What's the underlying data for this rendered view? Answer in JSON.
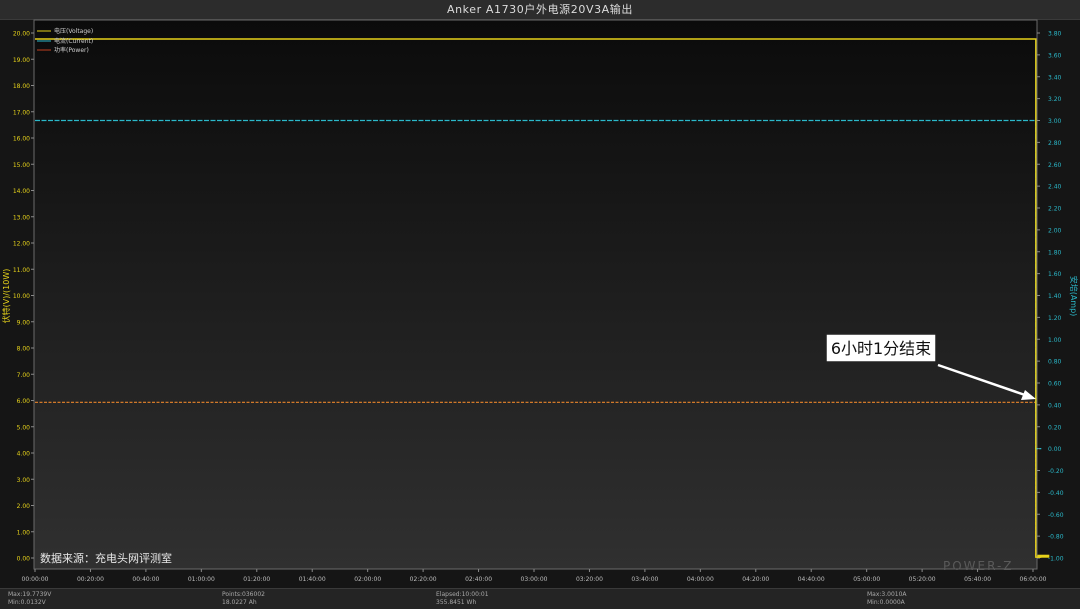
{
  "window": {
    "title": "Anker A1730户外电源20V3A输出"
  },
  "chart_data": {
    "type": "line",
    "title": "Anker A1730户外电源20V3A输出",
    "x_ticks": [
      "00:00:00",
      "00:20:00",
      "00:40:00",
      "01:00:00",
      "01:20:00",
      "01:40:00",
      "02:00:00",
      "02:20:00",
      "02:40:00",
      "03:00:00",
      "03:20:00",
      "03:40:00",
      "04:00:00",
      "04:20:00",
      "04:40:00",
      "05:00:00",
      "05:20:00",
      "05:40:00",
      "06:00:00"
    ],
    "x_minutes_range": [
      0,
      360
    ],
    "ylabel_left": "伏特(V)/(10W)",
    "ylabel_right": "安培(Amp)",
    "ylim_left": [
      0,
      20
    ],
    "ylim_right": [
      -1.0,
      3.8
    ],
    "y_ticks_left": [
      "0.00",
      "1.00",
      "2.00",
      "3.00",
      "4.00",
      "5.00",
      "6.00",
      "7.00",
      "8.00",
      "9.00",
      "10.00",
      "11.00",
      "12.00",
      "13.00",
      "14.00",
      "15.00",
      "16.00",
      "17.00",
      "18.00",
      "19.00",
      "20.00"
    ],
    "y_ticks_right": [
      "-1.00",
      "-0.80",
      "-0.60",
      "-0.40",
      "-0.20",
      "0.00",
      "0.20",
      "0.40",
      "0.60",
      "0.80",
      "1.00",
      "1.20",
      "1.40",
      "1.60",
      "1.80",
      "2.00",
      "2.20",
      "2.40",
      "2.60",
      "2.80",
      "3.00",
      "3.20",
      "3.40",
      "3.60",
      "3.80"
    ],
    "legend_position": "top-left",
    "grid": false,
    "series": [
      {
        "name": "电压(Voltage)",
        "axis": "left",
        "color": "#e6d21a",
        "points": [
          [
            0,
            19.77
          ],
          [
            361,
            19.77
          ],
          [
            361,
            0.03
          ],
          [
            363,
            0.03
          ]
        ]
      },
      {
        "name": "电流(Current)",
        "axis": "right",
        "color": "#2bb8c9",
        "points": [
          [
            0,
            3.0
          ],
          [
            361,
            3.0
          ],
          [
            361,
            0.0
          ],
          [
            363,
            0.0
          ]
        ]
      },
      {
        "name": "功率(Power)",
        "axis": "left",
        "color": "#e8842a",
        "points": [
          [
            0,
            5.93
          ],
          [
            361,
            5.93
          ],
          [
            361,
            0.0
          ]
        ]
      }
    ],
    "annotations": {
      "callout": "6小时1分结束",
      "source": "数据来源：充电头网评测室",
      "watermark": "POWER-Z"
    }
  },
  "footer": {
    "max_voltage": "Max:19.7739V",
    "min_voltage": "Min:0.0132V",
    "points": "Points:036002",
    "capacity": "18.0227 Ah",
    "elapsed": "Elapsed:10:00:01",
    "energy": "355.8451 Wh",
    "max_current": "Max:3.0010A",
    "min_current": "Min:0.0000A"
  }
}
